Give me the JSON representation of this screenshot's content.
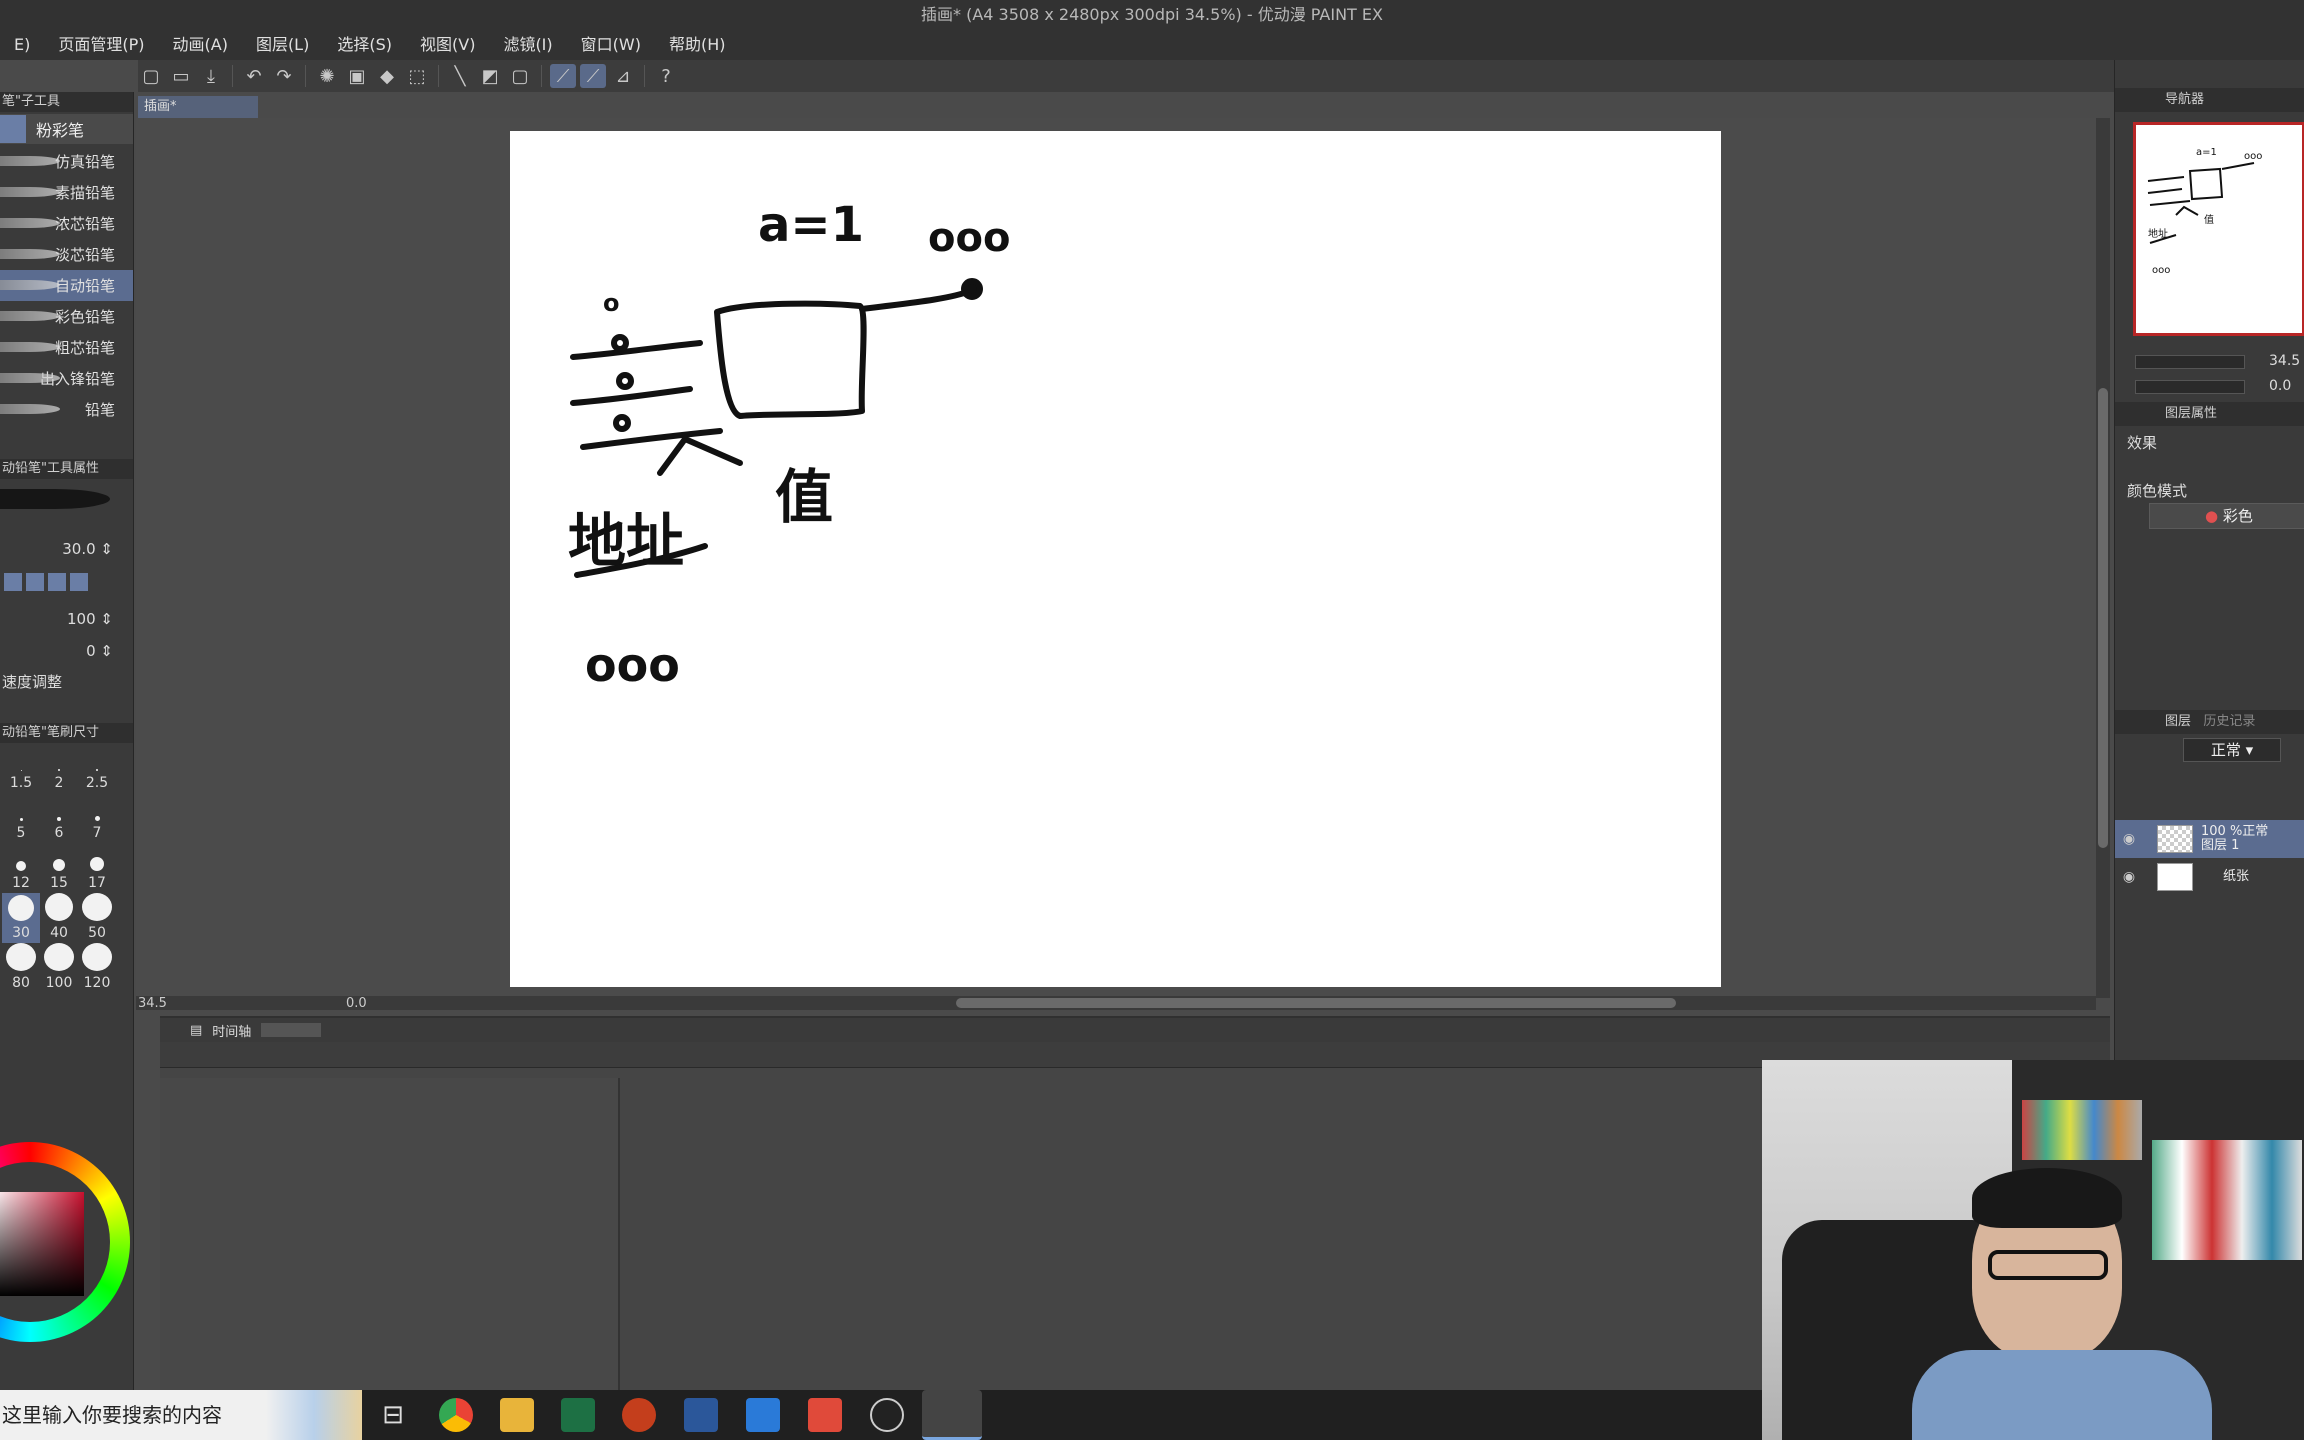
{
  "window": {
    "title": "插画* (A4 3508 x 2480px 300dpi 34.5%) - 优动漫 PAINT EX"
  },
  "menu": [
    {
      "label": "E)"
    },
    {
      "label": "页面管理(P)"
    },
    {
      "label": "动画(A)"
    },
    {
      "label": "图层(L)"
    },
    {
      "label": "选择(S)"
    },
    {
      "label": "视图(V)"
    },
    {
      "label": "滤镜(I)"
    },
    {
      "label": "窗口(W)"
    },
    {
      "label": "帮助(H)"
    }
  ],
  "left_panel": {
    "subtool_header": "笔\"子工具",
    "active_tab": "粉彩笔",
    "brushes": [
      {
        "label": "仿真铅笔"
      },
      {
        "label": "素描铅笔"
      },
      {
        "label": "浓芯铅笔"
      },
      {
        "label": "淡芯铅笔"
      },
      {
        "label": "自动铅笔"
      },
      {
        "label": "彩色铅笔"
      },
      {
        "label": "粗芯铅笔"
      },
      {
        "label": "出入锋铅笔"
      },
      {
        "label": "铅笔"
      }
    ],
    "tool_property_header": "动铅笔\"工具属性",
    "brush_size_value": "30.0",
    "opacity_value": "100",
    "third_value": "0",
    "speed_adjust_label": "速度调整",
    "brush_size_header": "动铅笔\"笔刷尺寸",
    "sizes": [
      "1.5",
      "2",
      "2.5",
      "5",
      "6",
      "7",
      "12",
      "15",
      "17",
      "30",
      "40",
      "50",
      "80",
      "100",
      "120"
    ],
    "selected_size": "30"
  },
  "document": {
    "tab_label": "插画*",
    "zoom": "34.5",
    "angle": "0.0"
  },
  "sketch_text": {
    "a_eq": "a=1",
    "ooo_top": "ooo",
    "small_o": "o",
    "address": "地址",
    "value": "值",
    "ooo_bottom": "ooo"
  },
  "timeline": {
    "tab_label": "时间轴"
  },
  "right_panel": {
    "navigator_label": "导航器",
    "zoom_val": "34.5",
    "rotate_val": "0.0",
    "layer_property_label": "图层属性",
    "effect_label": "效果",
    "color_mode_label": "颜色模式",
    "color_mode_value": "彩色",
    "layer_tab_label": "图层",
    "history_tab_label": "历史记录",
    "blend_mode": "正常",
    "layers": [
      {
        "opacity_mode": "100 %正常",
        "name": "图层 1"
      },
      {
        "opacity_mode": "",
        "name": "纸张"
      }
    ]
  },
  "taskbar": {
    "search_placeholder": "这里输入你要搜索的内容"
  },
  "colors": {
    "accent": "#5b6c90",
    "navigator_border": "#b82626"
  }
}
